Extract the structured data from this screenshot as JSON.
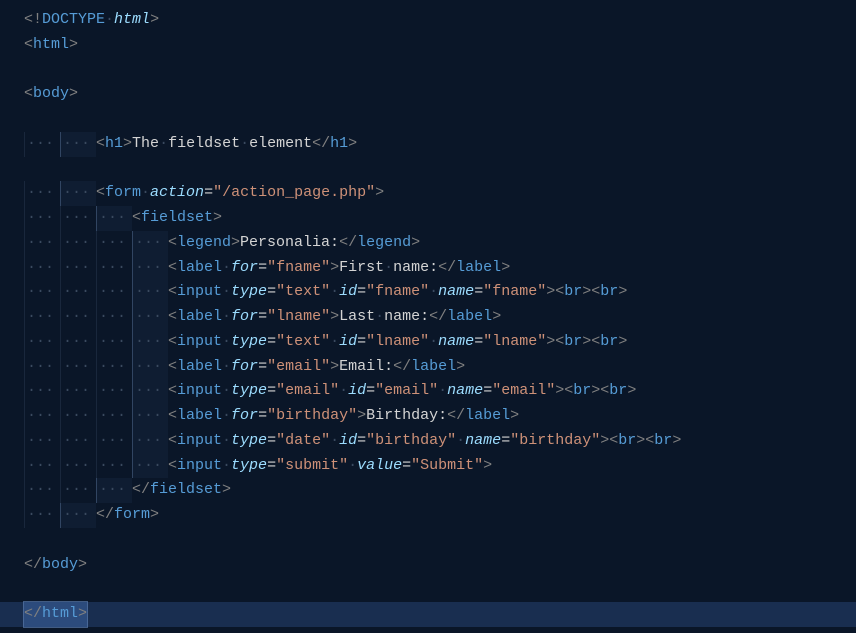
{
  "lines": [
    {
      "indent": 0,
      "tokens": [
        [
          "punct",
          "<!"
        ],
        [
          "doctype",
          "DOCTYPE"
        ],
        [
          "ws",
          " "
        ],
        [
          "doctype-name",
          "html"
        ],
        [
          "punct",
          ">"
        ]
      ]
    },
    {
      "indent": 0,
      "tokens": [
        [
          "punct",
          "<"
        ],
        [
          "tag",
          "html"
        ],
        [
          "punct",
          ">"
        ]
      ]
    },
    {
      "blank": true
    },
    {
      "indent": 0,
      "tokens": [
        [
          "punct",
          "<"
        ],
        [
          "tag",
          "body"
        ],
        [
          "punct",
          ">"
        ]
      ]
    },
    {
      "blank": true
    },
    {
      "indent": 2,
      "tokens": [
        [
          "punct",
          "<"
        ],
        [
          "tag",
          "h1"
        ],
        [
          "punct",
          ">"
        ],
        [
          "text",
          "The"
        ],
        [
          "ws",
          " "
        ],
        [
          "text",
          "fieldset"
        ],
        [
          "ws",
          " "
        ],
        [
          "text",
          "element"
        ],
        [
          "punct",
          "</"
        ],
        [
          "tag",
          "h1"
        ],
        [
          "punct",
          ">"
        ]
      ]
    },
    {
      "blank": true
    },
    {
      "indent": 2,
      "tokens": [
        [
          "punct",
          "<"
        ],
        [
          "tag",
          "form"
        ],
        [
          "ws",
          " "
        ],
        [
          "attr-name",
          "action"
        ],
        [
          "attr-eq",
          "="
        ],
        [
          "string",
          "\"/action_page.php\""
        ],
        [
          "punct",
          ">"
        ]
      ]
    },
    {
      "indent": 3,
      "tokens": [
        [
          "punct",
          "<"
        ],
        [
          "tag",
          "fieldset"
        ],
        [
          "punct",
          ">"
        ]
      ]
    },
    {
      "indent": 4,
      "tokens": [
        [
          "punct",
          "<"
        ],
        [
          "tag",
          "legend"
        ],
        [
          "punct",
          ">"
        ],
        [
          "text",
          "Personalia:"
        ],
        [
          "punct",
          "</"
        ],
        [
          "tag",
          "legend"
        ],
        [
          "punct",
          ">"
        ]
      ]
    },
    {
      "indent": 4,
      "tokens": [
        [
          "punct",
          "<"
        ],
        [
          "tag",
          "label"
        ],
        [
          "ws",
          " "
        ],
        [
          "attr-name",
          "for"
        ],
        [
          "attr-eq",
          "="
        ],
        [
          "string",
          "\"fname\""
        ],
        [
          "punct",
          ">"
        ],
        [
          "text",
          "First"
        ],
        [
          "ws",
          " "
        ],
        [
          "text",
          "name:"
        ],
        [
          "punct",
          "</"
        ],
        [
          "tag",
          "label"
        ],
        [
          "punct",
          ">"
        ]
      ]
    },
    {
      "indent": 4,
      "tokens": [
        [
          "punct",
          "<"
        ],
        [
          "tag",
          "input"
        ],
        [
          "ws",
          " "
        ],
        [
          "attr-name",
          "type"
        ],
        [
          "attr-eq",
          "="
        ],
        [
          "string",
          "\"text\""
        ],
        [
          "ws",
          " "
        ],
        [
          "attr-name",
          "id"
        ],
        [
          "attr-eq",
          "="
        ],
        [
          "string",
          "\"fname\""
        ],
        [
          "ws",
          " "
        ],
        [
          "attr-name",
          "name"
        ],
        [
          "attr-eq",
          "="
        ],
        [
          "string",
          "\"fname\""
        ],
        [
          "punct",
          ">"
        ],
        [
          "punct",
          "<"
        ],
        [
          "tag",
          "br"
        ],
        [
          "punct",
          ">"
        ],
        [
          "punct",
          "<"
        ],
        [
          "tag",
          "br"
        ],
        [
          "punct",
          ">"
        ]
      ]
    },
    {
      "indent": 4,
      "tokens": [
        [
          "punct",
          "<"
        ],
        [
          "tag",
          "label"
        ],
        [
          "ws",
          " "
        ],
        [
          "attr-name",
          "for"
        ],
        [
          "attr-eq",
          "="
        ],
        [
          "string",
          "\"lname\""
        ],
        [
          "punct",
          ">"
        ],
        [
          "text",
          "Last"
        ],
        [
          "ws",
          " "
        ],
        [
          "text",
          "name:"
        ],
        [
          "punct",
          "</"
        ],
        [
          "tag",
          "label"
        ],
        [
          "punct",
          ">"
        ]
      ]
    },
    {
      "indent": 4,
      "tokens": [
        [
          "punct",
          "<"
        ],
        [
          "tag",
          "input"
        ],
        [
          "ws",
          " "
        ],
        [
          "attr-name",
          "type"
        ],
        [
          "attr-eq",
          "="
        ],
        [
          "string",
          "\"text\""
        ],
        [
          "ws",
          " "
        ],
        [
          "attr-name",
          "id"
        ],
        [
          "attr-eq",
          "="
        ],
        [
          "string",
          "\"lname\""
        ],
        [
          "ws",
          " "
        ],
        [
          "attr-name",
          "name"
        ],
        [
          "attr-eq",
          "="
        ],
        [
          "string",
          "\"lname\""
        ],
        [
          "punct",
          ">"
        ],
        [
          "punct",
          "<"
        ],
        [
          "tag",
          "br"
        ],
        [
          "punct",
          ">"
        ],
        [
          "punct",
          "<"
        ],
        [
          "tag",
          "br"
        ],
        [
          "punct",
          ">"
        ]
      ]
    },
    {
      "indent": 4,
      "tokens": [
        [
          "punct",
          "<"
        ],
        [
          "tag",
          "label"
        ],
        [
          "ws",
          " "
        ],
        [
          "attr-name",
          "for"
        ],
        [
          "attr-eq",
          "="
        ],
        [
          "string",
          "\"email\""
        ],
        [
          "punct",
          ">"
        ],
        [
          "text",
          "Email:"
        ],
        [
          "punct",
          "</"
        ],
        [
          "tag",
          "label"
        ],
        [
          "punct",
          ">"
        ]
      ]
    },
    {
      "indent": 4,
      "tokens": [
        [
          "punct",
          "<"
        ],
        [
          "tag",
          "input"
        ],
        [
          "ws",
          " "
        ],
        [
          "attr-name",
          "type"
        ],
        [
          "attr-eq",
          "="
        ],
        [
          "string",
          "\"email\""
        ],
        [
          "ws",
          " "
        ],
        [
          "attr-name",
          "id"
        ],
        [
          "attr-eq",
          "="
        ],
        [
          "string",
          "\"email\""
        ],
        [
          "ws",
          " "
        ],
        [
          "attr-name",
          "name"
        ],
        [
          "attr-eq",
          "="
        ],
        [
          "string",
          "\"email\""
        ],
        [
          "punct",
          ">"
        ],
        [
          "punct",
          "<"
        ],
        [
          "tag",
          "br"
        ],
        [
          "punct",
          ">"
        ],
        [
          "punct",
          "<"
        ],
        [
          "tag",
          "br"
        ],
        [
          "punct",
          ">"
        ]
      ]
    },
    {
      "indent": 4,
      "tokens": [
        [
          "punct",
          "<"
        ],
        [
          "tag",
          "label"
        ],
        [
          "ws",
          " "
        ],
        [
          "attr-name",
          "for"
        ],
        [
          "attr-eq",
          "="
        ],
        [
          "string",
          "\"birthday\""
        ],
        [
          "punct",
          ">"
        ],
        [
          "text",
          "Birthday:"
        ],
        [
          "punct",
          "</"
        ],
        [
          "tag",
          "label"
        ],
        [
          "punct",
          ">"
        ]
      ]
    },
    {
      "indent": 4,
      "tokens": [
        [
          "punct",
          "<"
        ],
        [
          "tag",
          "input"
        ],
        [
          "ws",
          " "
        ],
        [
          "attr-name",
          "type"
        ],
        [
          "attr-eq",
          "="
        ],
        [
          "string",
          "\"date\""
        ],
        [
          "ws",
          " "
        ],
        [
          "attr-name",
          "id"
        ],
        [
          "attr-eq",
          "="
        ],
        [
          "string",
          "\"birthday\""
        ],
        [
          "ws",
          " "
        ],
        [
          "attr-name",
          "name"
        ],
        [
          "attr-eq",
          "="
        ],
        [
          "string",
          "\"birthday\""
        ],
        [
          "punct",
          ">"
        ],
        [
          "punct",
          "<"
        ],
        [
          "tag",
          "br"
        ],
        [
          "punct",
          ">"
        ],
        [
          "punct",
          "<"
        ],
        [
          "tag",
          "br"
        ],
        [
          "punct",
          ">"
        ]
      ]
    },
    {
      "indent": 4,
      "tokens": [
        [
          "punct",
          "<"
        ],
        [
          "tag",
          "input"
        ],
        [
          "ws",
          " "
        ],
        [
          "attr-name",
          "type"
        ],
        [
          "attr-eq",
          "="
        ],
        [
          "string",
          "\"submit\""
        ],
        [
          "ws",
          " "
        ],
        [
          "attr-name",
          "value"
        ],
        [
          "attr-eq",
          "="
        ],
        [
          "string",
          "\"Submit\""
        ],
        [
          "punct",
          ">"
        ]
      ]
    },
    {
      "indent": 3,
      "tokens": [
        [
          "punct",
          "</"
        ],
        [
          "tag",
          "fieldset"
        ],
        [
          "punct",
          ">"
        ]
      ]
    },
    {
      "indent": 2,
      "tokens": [
        [
          "punct",
          "</"
        ],
        [
          "tag",
          "form"
        ],
        [
          "punct",
          ">"
        ]
      ]
    },
    {
      "blank": true
    },
    {
      "indent": 0,
      "tokens": [
        [
          "punct",
          "</"
        ],
        [
          "tag",
          "body"
        ],
        [
          "punct",
          ">"
        ]
      ]
    },
    {
      "blank": true
    },
    {
      "indent": 0,
      "cursor": true,
      "tokens": [
        [
          "punct",
          "</"
        ],
        [
          "tag",
          "html"
        ],
        [
          "punct",
          ">"
        ]
      ]
    }
  ],
  "whitespace_dot": "·"
}
